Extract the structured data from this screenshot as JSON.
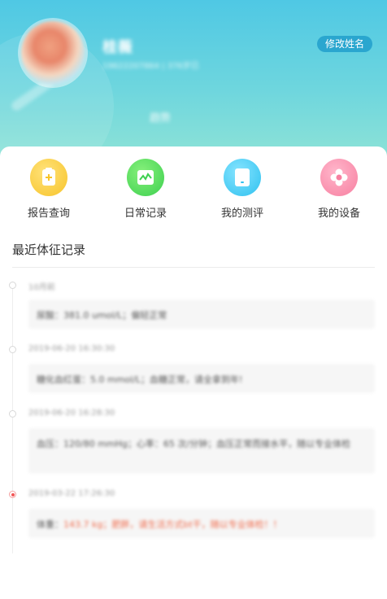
{
  "header": {
    "user_name": "桂薇",
    "user_sub": "19622207864 | 376岁已",
    "edit_label": "修改姓名",
    "center_tag": "趋势"
  },
  "nav": [
    {
      "label": "报告查询",
      "icon": "report-icon",
      "color": "#f7c42a"
    },
    {
      "label": "日常记录",
      "icon": "chart-icon",
      "color": "#3dd04f"
    },
    {
      "label": "我的测评",
      "icon": "tablet-icon",
      "color": "#2fc1ef"
    },
    {
      "label": "我的设备",
      "icon": "flower-icon",
      "color": "#f77fa0"
    }
  ],
  "section": {
    "title": "最近体征记录"
  },
  "records": [
    {
      "time": "10月前",
      "text": "尿酸：381.0 umol/L；偏轻正常"
    },
    {
      "time": "2019-06-20 16:30:30",
      "text": "糖化血红蛋：5.0 mmol/L；血糖正常，请全拿到年!"
    },
    {
      "time": "2019-06-20 16:28:30",
      "text": "血压：120/80 mmHg；心率：65 次/分钟；血压正常而接水平，随以专业体检"
    },
    {
      "time": "2019-03-22 17:26:30",
      "prefix": "体重：",
      "highlight": "143.7 kg；肥胖，请生活方式bt干，随以专业体检！！"
    }
  ]
}
